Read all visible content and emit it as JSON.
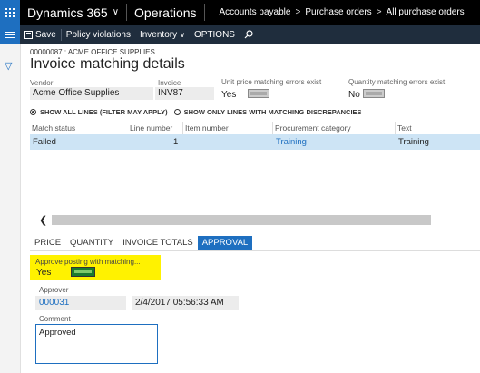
{
  "header": {
    "app_name": "Dynamics 365",
    "module": "Operations",
    "breadcrumbs": [
      "Accounts payable",
      "Purchase orders",
      "All purchase orders"
    ]
  },
  "actions": {
    "save": "Save",
    "policy_violations": "Policy violations",
    "inventory": "Inventory",
    "options": "OPTIONS"
  },
  "page": {
    "subtitle": "00000087 : ACME OFFICE SUPPLIES",
    "title": "Invoice matching details"
  },
  "summary": {
    "vendor_label": "Vendor",
    "vendor_value": "Acme Office Supplies",
    "invoice_label": "Invoice",
    "invoice_value": "INV87",
    "unit_price_label": "Unit price matching errors exist",
    "unit_price_value": "Yes",
    "quantity_label": "Quantity matching errors exist",
    "quantity_value": "No"
  },
  "filters": {
    "show_all": "SHOW ALL LINES (FILTER MAY APPLY)",
    "show_only": "SHOW ONLY LINES WITH MATCHING DISCREPANCIES"
  },
  "grid": {
    "columns": [
      "Match status",
      "Line number",
      "Item number",
      "Procurement category",
      "Text"
    ],
    "rows": [
      {
        "match_status": "Failed",
        "line_number": "1",
        "item_number": "",
        "procurement_category": "Training",
        "text": "Training"
      }
    ]
  },
  "tabs": [
    "PRICE",
    "QUANTITY",
    "INVOICE TOTALS",
    "APPROVAL"
  ],
  "approval": {
    "approve_label": "Approve posting with matching...",
    "approve_value": "Yes",
    "approver_label": "Approver",
    "approver_value": "000031",
    "approver_date": "2/4/2017 05:56:33 AM",
    "comment_label": "Comment",
    "comment_value": "Approved"
  },
  "colors": {
    "accent": "#1e6fc0",
    "highlight": "#fff200",
    "selected_row": "#cde4f5"
  }
}
